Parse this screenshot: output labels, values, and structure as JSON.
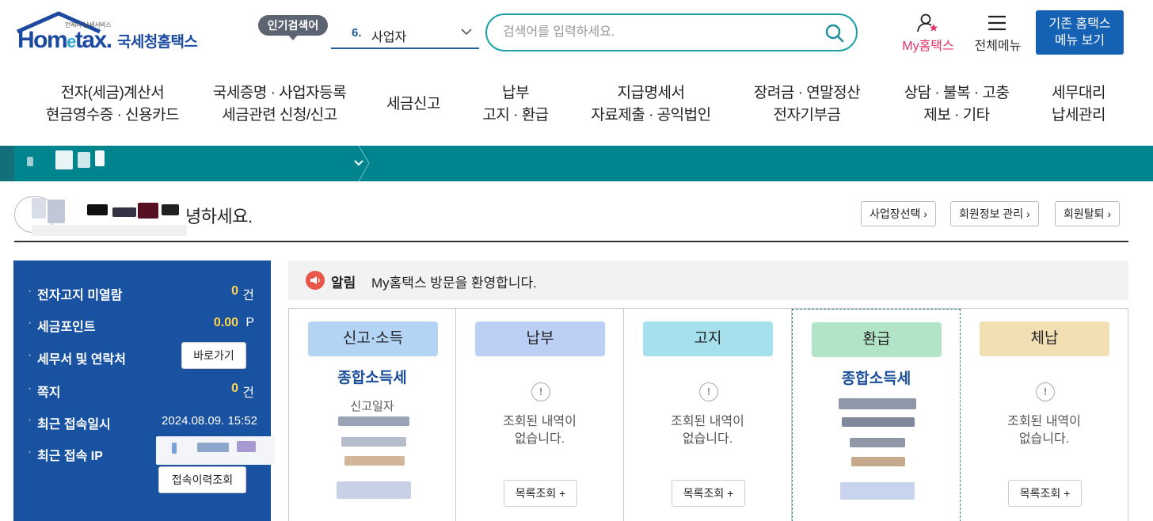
{
  "header": {
    "logo_sub": "언제나 납세서비스",
    "logo_brand": "Hometax",
    "logo_name": "국세청홈택스",
    "popular_badge": "인기검색어",
    "popular_rank": "6.",
    "popular_word": "사업자",
    "search_placeholder": "검색어를 입력하세요.",
    "my_hometax": "My홈택스",
    "all_menu": "전체메뉴",
    "old_menu_line1": "기존 홈택스",
    "old_menu_line2": "메뉴 보기"
  },
  "gnb": [
    {
      "l1": "전자(세금)계산서",
      "l2": "현금영수증 · 신용카드"
    },
    {
      "l1": "국세증명 · 사업자등록",
      "l2": "세금관련 신청/신고"
    },
    {
      "l1": "세금신고",
      "l2": ""
    },
    {
      "l1": "납부",
      "l2": "고지 · 환급"
    },
    {
      "l1": "지급명세서",
      "l2": "자료제출 · 공익법인"
    },
    {
      "l1": "장려금 · 연말정산",
      "l2": "전자기부금"
    },
    {
      "l1": "상담 · 불복 · 고충",
      "l2": "제보 · 기타"
    },
    {
      "l1": "세무대리",
      "l2": "납세관리"
    }
  ],
  "welcome": {
    "greeting_tail": "녕하세요.",
    "btn_workplace": "사업장선택 ›",
    "btn_member": "회원정보 관리 ›",
    "btn_withdraw": "회원탈퇴 ›"
  },
  "left_panel": {
    "rows": [
      {
        "label": "전자고지 미열람",
        "value": "0",
        "unit": "건"
      },
      {
        "label": "세금포인트",
        "value": "0.00",
        "unit": "P"
      },
      {
        "label": "세무서 및 연락처",
        "button": "바로가기"
      },
      {
        "label": "쪽지",
        "value": "0",
        "unit": "건"
      },
      {
        "label": "최근 접속일시",
        "date": "2024.08.09.  15:52"
      },
      {
        "label": "최근 접속 IP"
      }
    ],
    "history_button": "접속이력조회"
  },
  "notice": {
    "tag": "알림",
    "text": "My홈택스 방문을 환영합니다."
  },
  "cards": [
    {
      "chip": "신고·소득",
      "title": "종합소득세",
      "sub": "신고일자"
    },
    {
      "chip": "납부",
      "empty1": "조회된 내역이",
      "empty2": "없습니다.",
      "button": "목록조회 +"
    },
    {
      "chip": "고지",
      "empty1": "조회된 내역이",
      "empty2": "없습니다.",
      "button": "목록조회 +"
    },
    {
      "chip": "환급",
      "title": "종합소득세"
    },
    {
      "chip": "체납",
      "empty1": "조회된 내역이",
      "empty2": "없습니다.",
      "button": "목록조회 +"
    }
  ],
  "colors": {
    "brand_blue": "#1b4aa0",
    "teal": "#00858f",
    "panel_blue": "#1a52a2",
    "accent_pink": "#e0336a",
    "chip_report": "#b3d4f5",
    "chip_pay": "#bcd0f5",
    "chip_notice": "#a5e0ec",
    "chip_refund": "#b2e4c8",
    "chip_arrears": "#f2dfb4"
  }
}
